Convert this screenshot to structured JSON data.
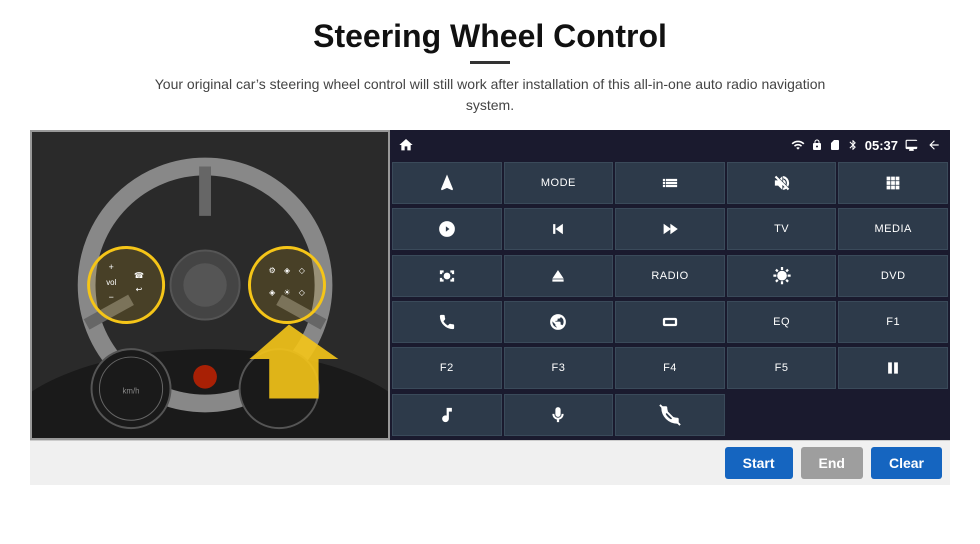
{
  "header": {
    "title": "Steering Wheel Control",
    "divider": true,
    "subtitle": "Your original car’s steering wheel control will still work after installation of this all-in-one auto radio navigation system."
  },
  "statusBar": {
    "home_icon": "home",
    "wifi_icon": "wifi",
    "lock_icon": "lock",
    "sim_icon": "sim",
    "bluetooth_icon": "bluetooth",
    "time": "05:37",
    "screen_icon": "screen",
    "back_icon": "back"
  },
  "buttons": [
    {
      "id": "r1c1",
      "type": "icon",
      "icon": "navigate",
      "label": ""
    },
    {
      "id": "r1c2",
      "type": "text",
      "label": "MODE"
    },
    {
      "id": "r1c3",
      "type": "icon",
      "icon": "list",
      "label": ""
    },
    {
      "id": "r1c4",
      "type": "icon",
      "icon": "mute",
      "label": ""
    },
    {
      "id": "r1c5",
      "type": "icon",
      "icon": "apps",
      "label": ""
    },
    {
      "id": "r2c1",
      "type": "icon",
      "icon": "settings-circle",
      "label": ""
    },
    {
      "id": "r2c2",
      "type": "icon",
      "icon": "rewind",
      "label": ""
    },
    {
      "id": "r2c3",
      "type": "icon",
      "icon": "fast-forward",
      "label": ""
    },
    {
      "id": "r2c4",
      "type": "text",
      "label": "TV"
    },
    {
      "id": "r2c5",
      "type": "text",
      "label": "MEDIA"
    },
    {
      "id": "r3c1",
      "type": "icon",
      "icon": "360-cam",
      "label": ""
    },
    {
      "id": "r3c2",
      "type": "icon",
      "icon": "eject",
      "label": ""
    },
    {
      "id": "r3c3",
      "type": "text",
      "label": "RADIO"
    },
    {
      "id": "r3c4",
      "type": "icon",
      "icon": "brightness",
      "label": ""
    },
    {
      "id": "r3c5",
      "type": "text",
      "label": "DVD"
    },
    {
      "id": "r4c1",
      "type": "icon",
      "icon": "phone",
      "label": ""
    },
    {
      "id": "r4c2",
      "type": "icon",
      "icon": "globe",
      "label": ""
    },
    {
      "id": "r4c3",
      "type": "icon",
      "icon": "aspect",
      "label": ""
    },
    {
      "id": "r4c4",
      "type": "text",
      "label": "EQ"
    },
    {
      "id": "r4c5",
      "type": "text",
      "label": "F1"
    },
    {
      "id": "r5c1",
      "type": "text",
      "label": "F2"
    },
    {
      "id": "r5c2",
      "type": "text",
      "label": "F3"
    },
    {
      "id": "r5c3",
      "type": "text",
      "label": "F4"
    },
    {
      "id": "r5c4",
      "type": "text",
      "label": "F5"
    },
    {
      "id": "r5c5",
      "type": "icon",
      "icon": "play-pause",
      "label": ""
    },
    {
      "id": "r6c1",
      "type": "icon",
      "icon": "music",
      "label": ""
    },
    {
      "id": "r6c2",
      "type": "icon",
      "icon": "mic",
      "label": ""
    },
    {
      "id": "r6c3",
      "type": "icon",
      "icon": "phone-mute",
      "label": ""
    },
    {
      "id": "r6c4",
      "type": "empty",
      "label": ""
    },
    {
      "id": "r6c5",
      "type": "empty",
      "label": ""
    }
  ],
  "actionBar": {
    "start_label": "Start",
    "end_label": "End",
    "clear_label": "Clear"
  }
}
